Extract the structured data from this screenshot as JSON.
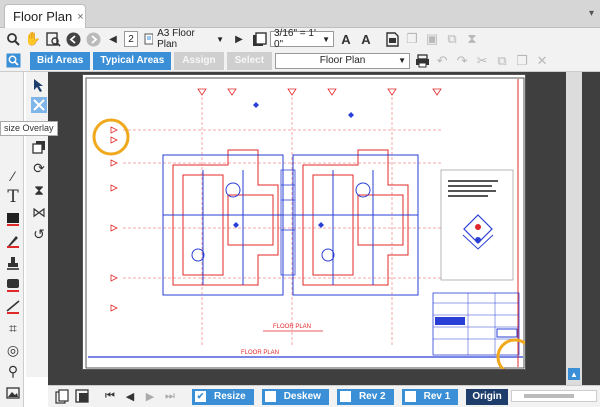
{
  "tab": {
    "title": "Floor Plan",
    "close": "×",
    "dropdown": "▾"
  },
  "toolbar1": {
    "page_number": "2",
    "sheet_name": "A3 Floor Plan",
    "scale": "3/16\" = 1' 0\""
  },
  "toolbar2": {
    "bid_areas": "Bid Areas",
    "typical_areas": "Typical Areas",
    "assign": "Assign",
    "select": "Select",
    "layer": "Floor Plan"
  },
  "sidebar": {
    "tooltip": "size Overlay"
  },
  "drawing": {
    "title": "FLOOR PLAN",
    "highlight_color": "#f0a81c",
    "line_red": "#e0282a",
    "line_blue": "#2a3fd6"
  },
  "bottombar": {
    "resize": "Resize",
    "deskew": "Deskew",
    "rev2": "Rev 2",
    "rev1": "Rev 1",
    "original": "Origin"
  },
  "icons": [
    "search-icon",
    "hand-icon",
    "page-zoom-icon",
    "back-icon",
    "forward-icon",
    "prev-page-icon",
    "next-page-icon",
    "text-height-icon",
    "print-icon",
    "undo-icon",
    "redo-icon",
    "cut-icon",
    "copy-icon",
    "paste-icon",
    "delete-icon"
  ]
}
